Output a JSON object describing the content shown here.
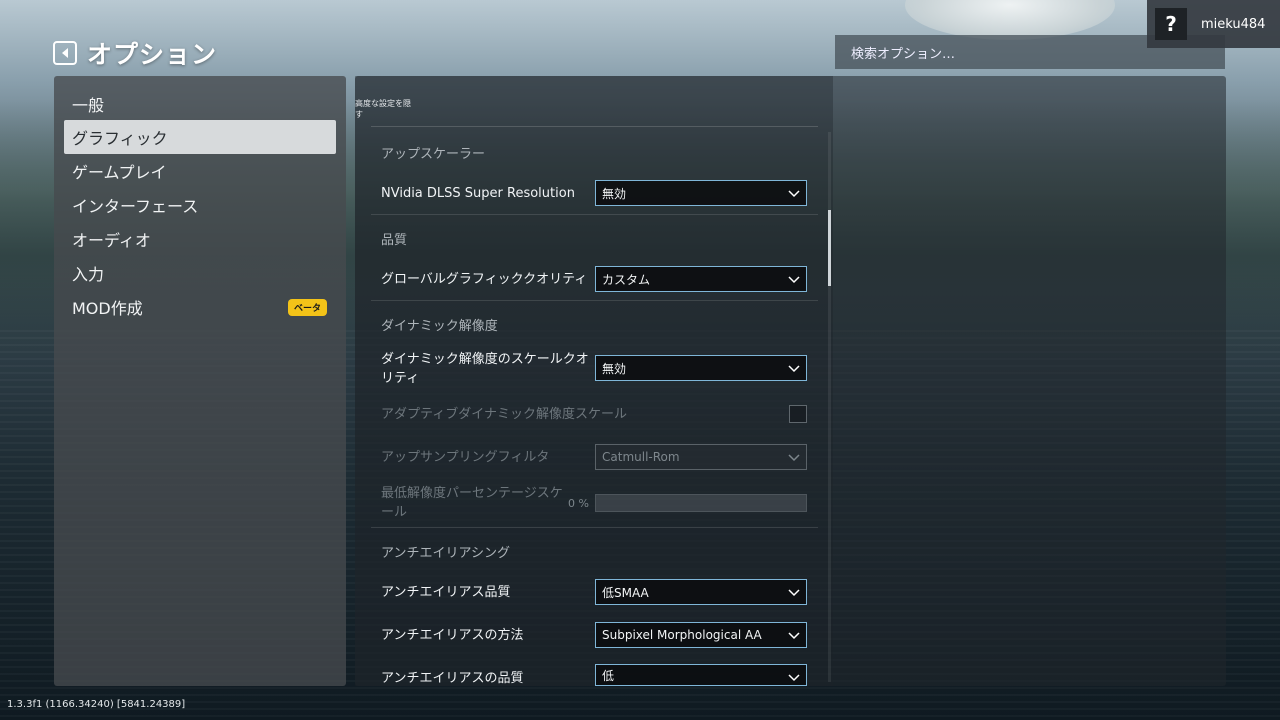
{
  "header": {
    "title": "オプション",
    "search_placeholder": "検索オプション…",
    "username": "mieku484",
    "help_glyph": "?"
  },
  "sidebar": {
    "items": [
      {
        "label": "一般",
        "active": false
      },
      {
        "label": "グラフィック",
        "active": true
      },
      {
        "label": "ゲームプレイ",
        "active": false
      },
      {
        "label": "インターフェース",
        "active": false
      },
      {
        "label": "オーディオ",
        "active": false
      },
      {
        "label": "入力",
        "active": false
      },
      {
        "label": "MOD作成",
        "active": false,
        "badge": "ベータ"
      }
    ]
  },
  "main": {
    "hide_advanced": "高度な設定を隠す",
    "sections": {
      "upscaler": {
        "title": "アップスケーラー",
        "dlss_label": "NVidia DLSS Super Resolution",
        "dlss_value": "無効"
      },
      "quality": {
        "title": "品質",
        "global_label": "グローバルグラフィッククオリティ",
        "global_value": "カスタム"
      },
      "dynamic": {
        "title": "ダイナミック解像度",
        "scale_quality_label": "ダイナミック解像度のスケールクオリティ",
        "scale_quality_value": "無効",
        "adaptive_label": "アダプティブダイナミック解像度スケール",
        "adaptive_checked": false,
        "upsampling_label": "アップサンプリングフィルタ",
        "upsampling_value": "Catmull-Rom",
        "min_percent_label": "最低解像度パーセンテージスケール",
        "min_percent_value": "0 %"
      },
      "antialiasing": {
        "title": "アンチエイリアシング",
        "aa_quality_label": "アンチエイリアス品質",
        "aa_quality_value": "低SMAA",
        "aa_method_label": "アンチエイリアスの方法",
        "aa_method_value": "Subpixel Morphological AA",
        "aa_quality2_label": "アンチエイリアスの品質",
        "aa_quality2_value": "低"
      }
    }
  },
  "footer": {
    "version": "1.3.3f1 (1166.34240) [5841.24389]"
  },
  "colors": {
    "dropdown_border": "#7fb6d8",
    "beta_badge": "#f3c318",
    "active_item_bg": "#d7dadc"
  }
}
